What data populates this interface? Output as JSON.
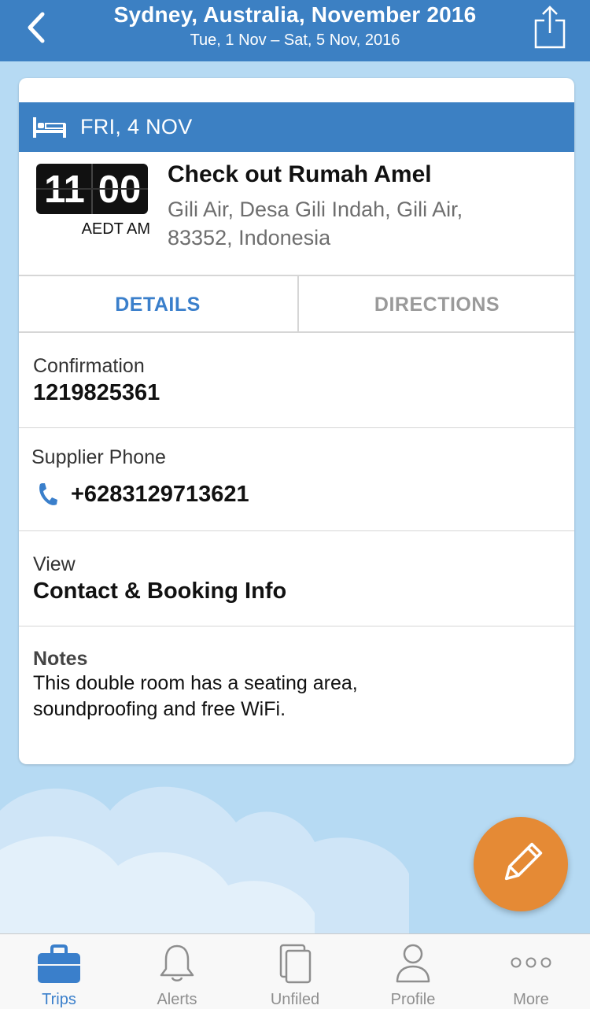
{
  "header": {
    "title": "Sydney, Australia, November 2016",
    "subtitle": "Tue, 1 Nov – Sat, 5 Nov, 2016",
    "back_icon": "chevron-left-icon",
    "share_icon": "share-icon"
  },
  "card": {
    "day_label": "FRI, 4 NOV",
    "day_icon": "bed-icon",
    "time_hours": "11",
    "time_minutes": "00",
    "timezone": "AEDT AM",
    "event_title": "Check out Rumah Amel",
    "address_line1": "Gili Air, Desa Gili Indah, Gili Air,",
    "address_line2": "83352, Indonesia",
    "tabs": {
      "details": "DETAILS",
      "directions": "DIRECTIONS"
    },
    "confirmation": {
      "label": "Confirmation",
      "value": "1219825361"
    },
    "supplier_phone": {
      "label": "Supplier Phone",
      "value": "+6283129713621",
      "icon": "phone-icon"
    },
    "view": {
      "label": "View",
      "value": "Contact & Booking Info"
    },
    "notes": {
      "label": "Notes",
      "line1": "This double room has a seating area,",
      "line2": "soundproofing and free WiFi."
    }
  },
  "fab": {
    "icon": "pencil-icon"
  },
  "tabbar": {
    "items": [
      {
        "label": "Trips",
        "icon": "briefcase-icon",
        "active": true
      },
      {
        "label": "Alerts",
        "icon": "bell-icon",
        "active": false
      },
      {
        "label": "Unfiled",
        "icon": "documents-icon",
        "active": false
      },
      {
        "label": "Profile",
        "icon": "person-icon",
        "active": false
      },
      {
        "label": "More",
        "icon": "more-dots-icon",
        "active": false
      }
    ]
  },
  "colors": {
    "brand_blue": "#3c80c3",
    "background_sky": "#b6daf3",
    "accent_orange": "#e58a35",
    "active_tab": "#3a7fcb"
  }
}
